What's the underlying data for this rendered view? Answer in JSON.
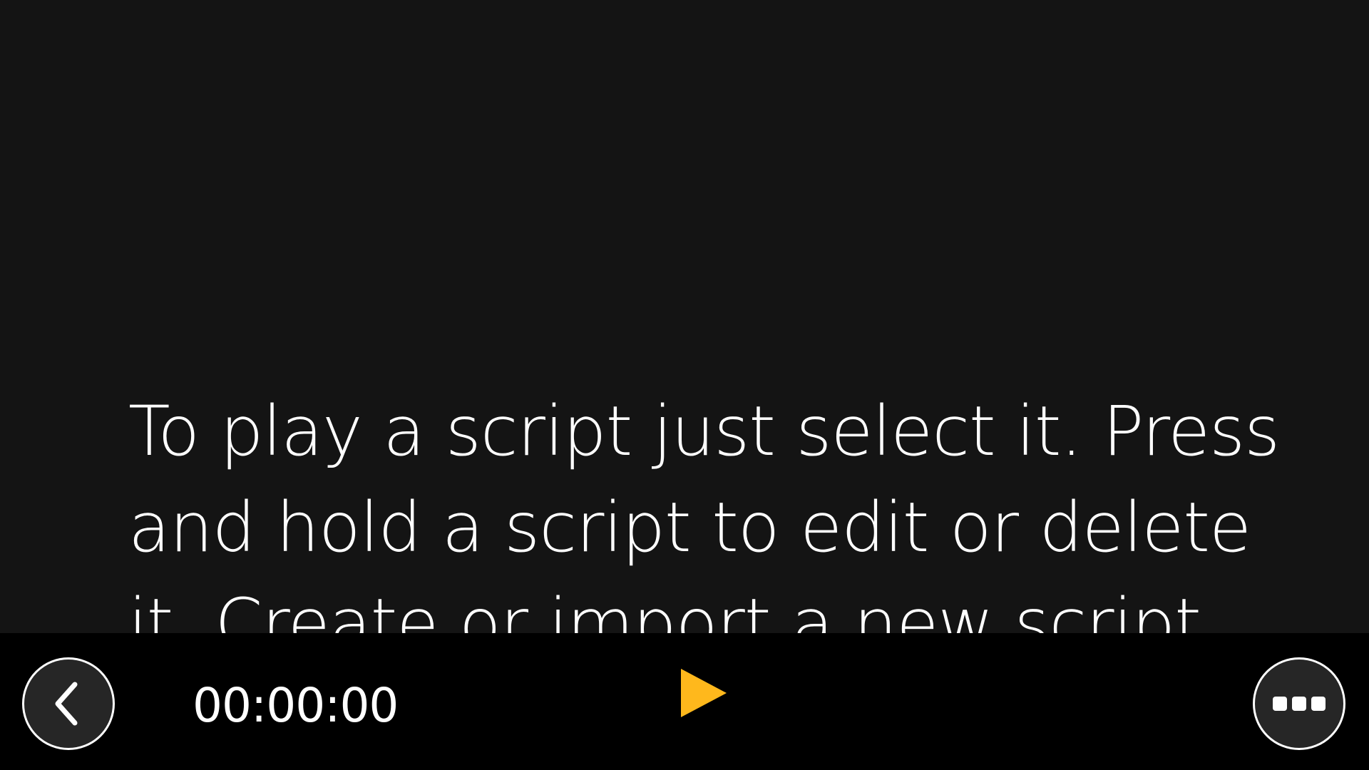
{
  "main": {
    "instructions": "To play a script just select it. Press and hold a script to edit or delete it. Create or import a new script by pressing the ••• button."
  },
  "toolbar": {
    "timecode": "00:00:00",
    "back_icon": "chevron-left-icon",
    "play_icon": "play-icon",
    "more_icon": "more-horizontal-icon",
    "accent_color": "#FFB81C"
  },
  "colors": {
    "background": "#141414",
    "toolbar_background": "#000000",
    "button_fill": "#262626",
    "text": "#FFFFFF"
  }
}
